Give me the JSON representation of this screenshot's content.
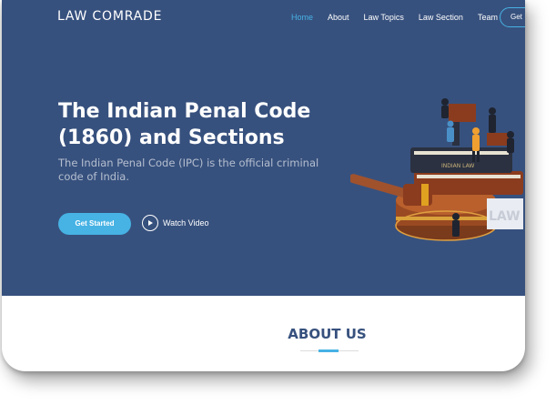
{
  "header": {
    "brand": "LAW COMRADE",
    "nav": [
      {
        "label": "Home",
        "active": true
      },
      {
        "label": "About",
        "active": false
      },
      {
        "label": "Law Topics",
        "active": false
      },
      {
        "label": "Law Section",
        "active": false
      },
      {
        "label": "Team",
        "active": false
      }
    ],
    "cta_label": "Get"
  },
  "hero": {
    "title_line1": "The Indian Penal Code",
    "title_line2": "(1860) and Sections",
    "subtitle": "The Indian Penal Code (IPC) is the official criminal code of India.",
    "primary_button": "Get Started",
    "video_link": "Watch Video",
    "illustration_book_text": "INDIAN LAW",
    "illustration_block_text": "LAW"
  },
  "about": {
    "title": "ABOUT US"
  },
  "colors": {
    "hero_bg": "#37517e",
    "accent": "#47b2e4",
    "white": "#ffffff"
  },
  "icons": [
    "play-icon",
    "court-illustration"
  ]
}
